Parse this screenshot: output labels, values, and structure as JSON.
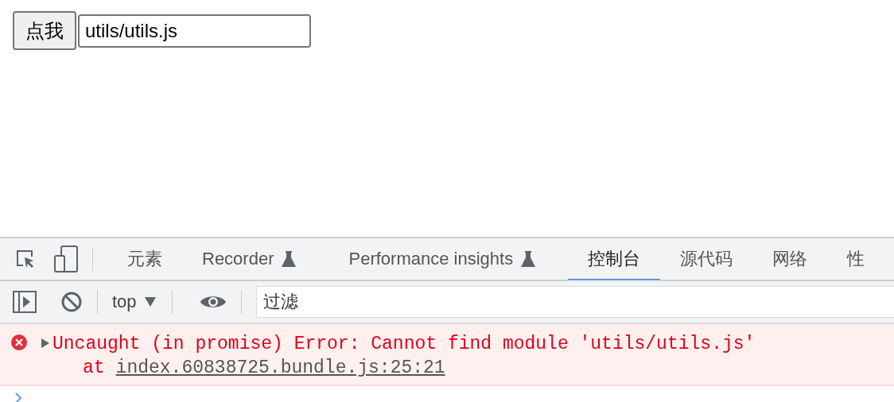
{
  "page": {
    "button": "点我",
    "input_value": "utils/utils.js"
  },
  "devtools": {
    "tabs": [
      {
        "label": "元素",
        "selected": false,
        "experimental": false
      },
      {
        "label": "Recorder",
        "selected": false,
        "experimental": true
      },
      {
        "label": "Performance insights",
        "selected": false,
        "experimental": true
      },
      {
        "label": "控制台",
        "selected": true,
        "experimental": false
      },
      {
        "label": "源代码",
        "selected": false,
        "experimental": false
      },
      {
        "label": "网络",
        "selected": false,
        "experimental": false
      },
      {
        "label": "性",
        "selected": false,
        "experimental": false
      }
    ],
    "toolbar": {
      "context": "top",
      "filter_placeholder": "过滤"
    },
    "console": {
      "messages": [
        {
          "kind": "error",
          "expanded": false,
          "text": "Uncaught (in promise) Error: Cannot find module 'utils/utils.js'",
          "location_prefix": "at",
          "location": "index.60838725.bundle.js:25:21"
        }
      ]
    }
  }
}
